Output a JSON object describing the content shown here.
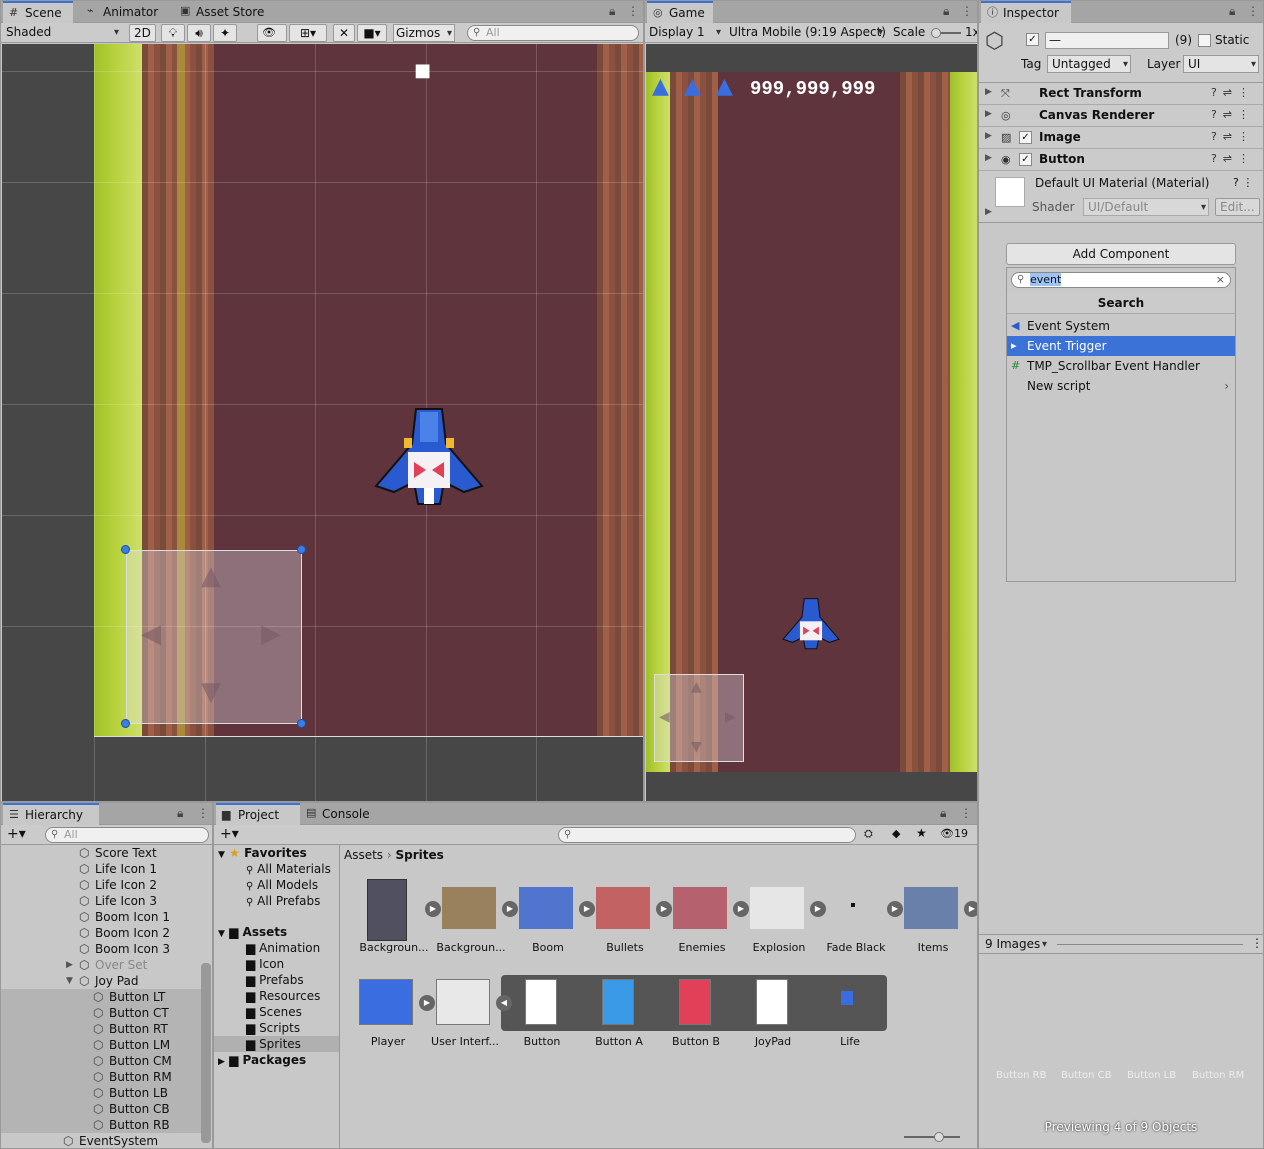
{
  "scene": {
    "tabs": [
      "Scene",
      "Animator",
      "Asset Store"
    ],
    "shading": "Shaded",
    "btn_2d": "2D",
    "hidden_count": "1",
    "gizmos": "Gizmos",
    "search_placeholder": "All"
  },
  "game": {
    "tab": "Game",
    "display": "Display 1",
    "aspect": "Ultra Mobile (9:19 Aspect)",
    "scale_label": "Scale",
    "scale_value": "1x",
    "score": "999,999,999"
  },
  "inspector": {
    "tab": "Inspector",
    "object_name": "—",
    "count": "(9)",
    "static_label": "Static",
    "tag_label": "Tag",
    "tag_value": "Untagged",
    "layer_label": "Layer",
    "layer_value": "UI",
    "components": [
      "Rect Transform",
      "Canvas Renderer",
      "Image",
      "Button"
    ],
    "material_name": "Default UI Material (Material)",
    "shader_label": "Shader",
    "shader_value": "UI/Default",
    "edit_label": "Edit...",
    "add_component": "Add Component",
    "search_value": "event",
    "search_header": "Search",
    "results": [
      "Event System",
      "Event Trigger",
      "TMP_Scrollbar Event Handler",
      "New script"
    ],
    "preview_dropdown": "9 Images",
    "preview_labels": [
      "Button RB",
      "Button CB",
      "Button LB",
      "Button RM"
    ],
    "preview_status": "Previewing 4 of 9 Objects"
  },
  "hierarchy": {
    "tab": "Hierarchy",
    "search_placeholder": "All",
    "items": [
      {
        "label": "Score Text",
        "indent": 1
      },
      {
        "label": "Life Icon 1",
        "indent": 1
      },
      {
        "label": "Life Icon 2",
        "indent": 1
      },
      {
        "label": "Life Icon 3",
        "indent": 1
      },
      {
        "label": "Boom Icon 1",
        "indent": 1
      },
      {
        "label": "Boom Icon 2",
        "indent": 1
      },
      {
        "label": "Boom Icon 3",
        "indent": 1
      },
      {
        "label": "Over Set",
        "indent": 1
      },
      {
        "label": "Joy Pad",
        "indent": 1
      },
      {
        "label": "Button LT",
        "indent": 2
      },
      {
        "label": "Button CT",
        "indent": 2
      },
      {
        "label": "Button RT",
        "indent": 2
      },
      {
        "label": "Button LM",
        "indent": 2
      },
      {
        "label": "Button CM",
        "indent": 2
      },
      {
        "label": "Button RM",
        "indent": 2
      },
      {
        "label": "Button LB",
        "indent": 2
      },
      {
        "label": "Button CB",
        "indent": 2
      },
      {
        "label": "Button RB",
        "indent": 2
      },
      {
        "label": "EventSystem",
        "indent": 0
      }
    ]
  },
  "project": {
    "tabs": [
      "Project",
      "Console"
    ],
    "hidden_count": "19",
    "favorites": "Favorites",
    "fav_items": [
      "All Materials",
      "All Models",
      "All Prefabs"
    ],
    "assets": "Assets",
    "folders": [
      "Animation",
      "Icon",
      "Prefabs",
      "Resources",
      "Scenes",
      "Scripts",
      "Sprites"
    ],
    "packages": "Packages",
    "breadcrumb": [
      "Assets",
      "Sprites"
    ],
    "grid_row1": [
      "Backgroun...",
      "Backgroun...",
      "Boom",
      "Bullets",
      "Enemies",
      "Explosion",
      "Fade Black",
      "Items"
    ],
    "grid_row2": [
      "Player",
      "User Interf...",
      "Button",
      "Button A",
      "Button B",
      "JoyPad",
      "Life"
    ]
  },
  "colors": {
    "accent": "#3a72d8",
    "road": "#5f343c",
    "grass": "#b5d03a"
  }
}
